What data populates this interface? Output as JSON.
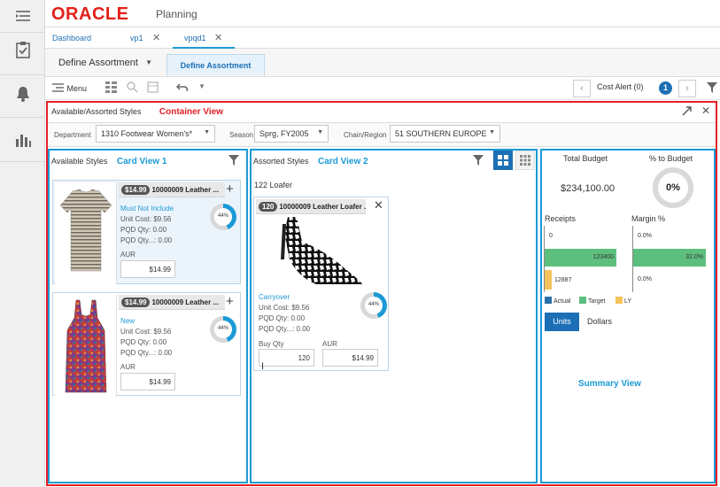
{
  "app": {
    "brand": "ORACLE",
    "product": "Planning"
  },
  "colors": {
    "oracle_red": "#e32119",
    "accent_blue": "#1c9ad6",
    "container_border": "#e41e26",
    "actual": "#2a6fa8",
    "target": "#5dbf7d",
    "ly": "#f5c35a"
  },
  "rail": {
    "icons": [
      "menu-icon",
      "tasks-icon",
      "notifications-icon",
      "reports-icon"
    ]
  },
  "tabs": [
    {
      "label": "Dashboard"
    },
    {
      "label": "vp1"
    },
    {
      "label": "vpqd1"
    }
  ],
  "subnav": {
    "dropdown": "Define Assortment",
    "active_tab": "Define Assortment"
  },
  "toolbar": {
    "menu_label": "Menu",
    "cost_alert": "Cost Alert (0)",
    "info_count": "1"
  },
  "container": {
    "title": "Available/Assorted Styles",
    "annotation": "Container View",
    "filters": [
      {
        "label": "Department",
        "value": "1310 Footwear Women's*"
      },
      {
        "label": "Season",
        "value": "Sprg, FY2005"
      },
      {
        "label": "Chain/Region",
        "value": "51 SOUTHERN EUROPE"
      }
    ]
  },
  "available": {
    "title": "Available Styles",
    "annotation": "Card View 1",
    "cards": [
      {
        "price": "$14.99",
        "title": "10000009 Leather ...",
        "status": "Must Not Include",
        "unit_cost": "Unit Cost: $9.56",
        "pqd_qty": "PQD Qty: 0.00",
        "pqd_qty2": "PQD Qty...: 0.00",
        "aur_label": "AUR",
        "aur": "$14.99",
        "pct": "44%"
      },
      {
        "price": "$14.99",
        "title": "10000009 Leather ...",
        "status": "New",
        "unit_cost": "Unit Cost: $9.56",
        "pqd_qty": "PQD Qty: 0.00",
        "pqd_qty2": "PQD Qty...: 0.00",
        "aur_label": "AUR",
        "aur": "$14.99",
        "pct": "44%"
      }
    ]
  },
  "assorted": {
    "title": "Assorted Styles",
    "annotation": "Card View 2",
    "group": "122 Loafer",
    "card": {
      "count": "120",
      "title": "10000009 Leather Loafer ...",
      "status": "Carryover",
      "unit_cost": "Unit Cost: $9.56",
      "pqd_qty": "PQD Qty: 0.00",
      "pqd_qty2": "PQD Qty...: 0.00",
      "buy_qty_label": "Buy Qty",
      "buy_qty": "120",
      "aur_label": "AUR",
      "aur": "$14.99",
      "pct": "44%"
    }
  },
  "summary": {
    "total_budget_label": "Total Budget",
    "total_budget": "$234,100.00",
    "pct_budget_label": "% to Budget",
    "pct_budget": "0%",
    "receipts_label": "Receipts",
    "margin_label": "Margin %",
    "receipts_vals": [
      "0",
      "123400",
      "12887"
    ],
    "margin_vals": [
      "0.0%",
      "32.0%",
      "0.0%"
    ],
    "legend": [
      "Actual",
      "Target",
      "LY"
    ],
    "units_label": "Units",
    "dollars_label": "Dollars",
    "annotation": "Summary View"
  }
}
